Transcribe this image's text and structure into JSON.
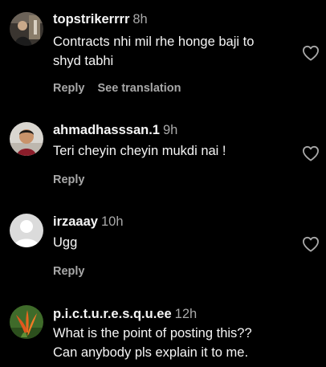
{
  "comments": [
    {
      "username": "topstrikerrrr",
      "time": "8h",
      "text_line1": "Contracts nhi mil rhe honge baji to",
      "text_line2": "shyd tabhi",
      "reply_label": "Reply",
      "translation_label": "See translation"
    },
    {
      "username": "ahmadhasssan.1",
      "time": "9h",
      "text_line1": "Teri cheyin cheyin mukdi nai !",
      "reply_label": "Reply"
    },
    {
      "username": "irzaaay",
      "time": "10h",
      "text_line1": "Ugg",
      "reply_label": "Reply"
    },
    {
      "username": "p.i.c.t.u.r.e.s.q.u.ee",
      "time": "12h",
      "text_line1": "What is the point of posting this??",
      "text_line2": "Can anybody pls explain it to me."
    }
  ],
  "icons": {
    "like": "heart-outline-icon",
    "default_avatar": "default-avatar-icon"
  },
  "colors": {
    "background": "#000000",
    "primary_text": "#f5f5f5",
    "secondary_text": "#a8a8a8"
  }
}
